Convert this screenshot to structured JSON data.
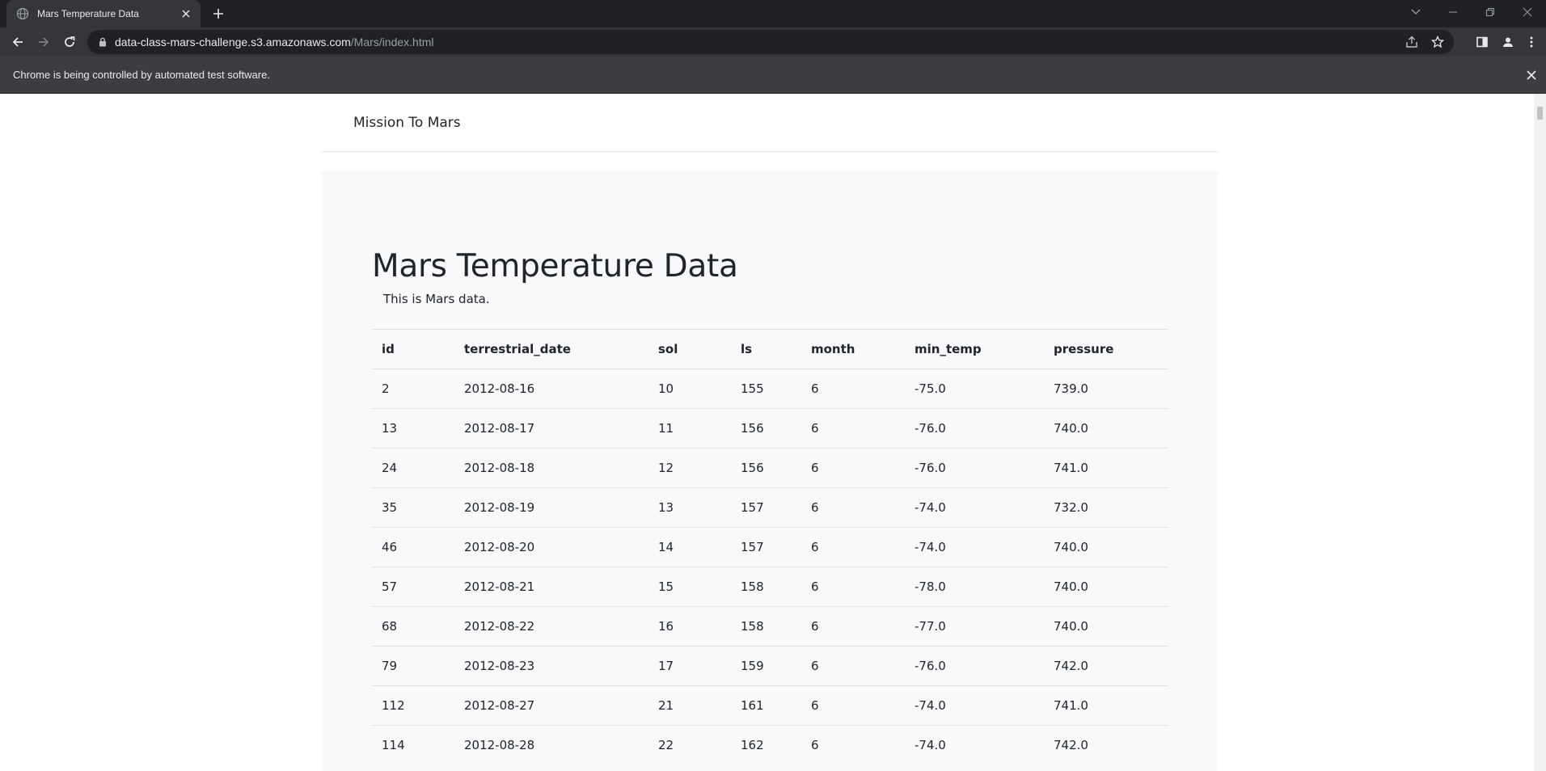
{
  "browser": {
    "tab_title": "Mars Temperature Data",
    "url_host": "data-class-mars-challenge.s3.amazonaws.com",
    "url_path": "/Mars/index.html",
    "infobar_text": "Chrome is being controlled by automated test software."
  },
  "icons": {
    "favicon": "globe-icon",
    "tab_close": "close-icon",
    "new_tab": "plus-icon",
    "back": "arrow-left-icon",
    "forward": "arrow-right-icon",
    "reload": "reload-icon",
    "lock": "lock-icon",
    "share": "share-icon",
    "bookmark": "star-icon",
    "side_panel": "side-panel-icon",
    "profile": "profile-icon",
    "menu": "kebab-menu-icon"
  },
  "page": {
    "brand": "Mission To Mars",
    "heading": "Mars Temperature Data",
    "lead": "This is Mars data."
  },
  "table": {
    "headers": [
      "id",
      "terrestrial_date",
      "sol",
      "ls",
      "month",
      "min_temp",
      "pressure"
    ],
    "rows": [
      [
        "2",
        "2012-08-16",
        "10",
        "155",
        "6",
        "-75.0",
        "739.0"
      ],
      [
        "13",
        "2012-08-17",
        "11",
        "156",
        "6",
        "-76.0",
        "740.0"
      ],
      [
        "24",
        "2012-08-18",
        "12",
        "156",
        "6",
        "-76.0",
        "741.0"
      ],
      [
        "35",
        "2012-08-19",
        "13",
        "157",
        "6",
        "-74.0",
        "732.0"
      ],
      [
        "46",
        "2012-08-20",
        "14",
        "157",
        "6",
        "-74.0",
        "740.0"
      ],
      [
        "57",
        "2012-08-21",
        "15",
        "158",
        "6",
        "-78.0",
        "740.0"
      ],
      [
        "68",
        "2012-08-22",
        "16",
        "158",
        "6",
        "-77.0",
        "740.0"
      ],
      [
        "79",
        "2012-08-23",
        "17",
        "159",
        "6",
        "-76.0",
        "742.0"
      ],
      [
        "112",
        "2012-08-27",
        "21",
        "161",
        "6",
        "-74.0",
        "741.0"
      ],
      [
        "114",
        "2012-08-28",
        "22",
        "162",
        "6",
        "-74.0",
        "742.0"
      ]
    ]
  }
}
